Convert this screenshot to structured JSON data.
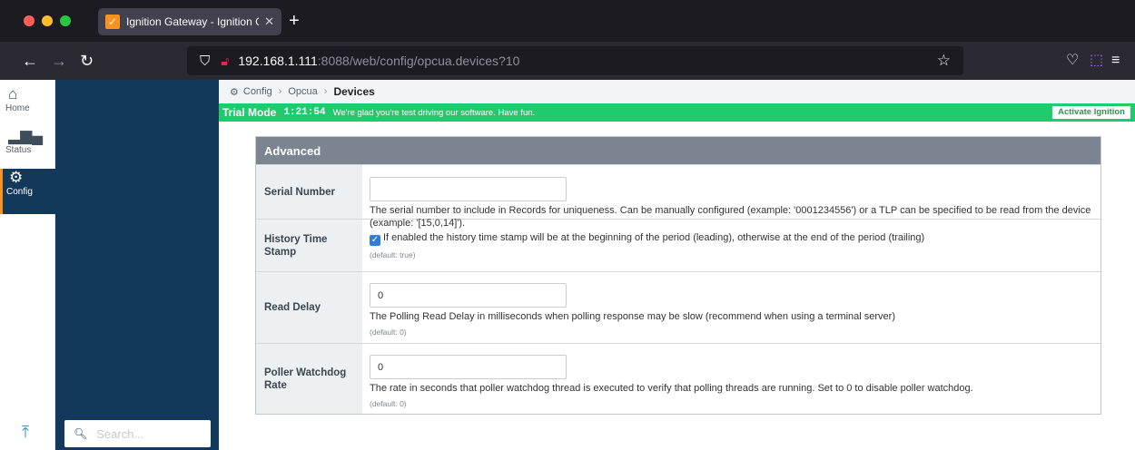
{
  "browser": {
    "tab": {
      "title": "Ignition Gateway - Ignition Gate",
      "favicon_glyph": "✓"
    },
    "url": {
      "host": "192.168.1.111",
      "rest": ":8088/web/config/opcua.devices?10"
    }
  },
  "rail": {
    "items": [
      {
        "label": "Home",
        "icon": "home-icon"
      },
      {
        "label": "Status",
        "icon": "bar-chart-icon"
      },
      {
        "label": "Config",
        "icon": "gear-icon"
      }
    ]
  },
  "side": {
    "search_placeholder": "Search..."
  },
  "breadcrumb": {
    "items": [
      "Config",
      "Opcua"
    ],
    "current": "Devices"
  },
  "trial": {
    "mode": "Trial Mode",
    "time": "1:21:54",
    "message": "We're glad you're test driving our software. Have fun.",
    "button": "Activate Ignition"
  },
  "form": {
    "section": "Advanced",
    "serial": {
      "label": "Serial Number",
      "value": "",
      "desc": "The serial number to include in Records for uniqueness. Can be manually configured (example: '0001234556') or a TLP can be specified to be read from the device (example: '[15,0,14]')."
    },
    "history": {
      "label": "History Time Stamp",
      "checked": true,
      "desc": "If enabled the history time stamp will be at the beginning of the period (leading), otherwise at the end of the period (trailing)",
      "default": "(default: true)"
    },
    "delay": {
      "label": "Read Delay",
      "value": "0",
      "desc": "The Polling Read Delay in milliseconds when polling response may be slow (recommend when using a terminal server)",
      "default": "(default: 0)"
    },
    "watchdog": {
      "label": "Poller Watchdog Rate",
      "value": "0",
      "desc": "The rate in seconds that poller watchdog thread is executed to verify that polling threads are running. Set to 0 to disable poller watchdog.",
      "default": "(default: 0)"
    }
  },
  "colors": {
    "sidebar": "#12395c",
    "trial_bar": "#1fcb6c",
    "section_header": "#7b8591",
    "accent": "#f7931e"
  }
}
